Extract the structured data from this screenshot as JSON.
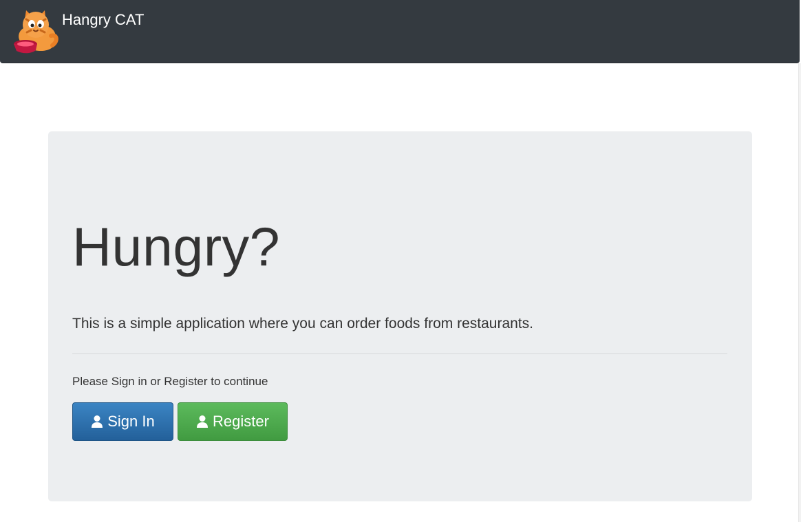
{
  "navbar": {
    "brand_name": "Hangry CAT",
    "logo_icon": "hungry-cat-logo-icon"
  },
  "jumbotron": {
    "title": "Hungry?",
    "lead": "This is a simple application where you can order foods from restaurants.",
    "prompt": "Please Sign in or Register to continue"
  },
  "actions": {
    "sign_in_label": "Sign In",
    "register_label": "Register",
    "sign_in_icon": "user-icon",
    "register_icon": "user-icon"
  },
  "colors": {
    "navbar_bg": "#343a40",
    "jumbotron_bg": "#eceef0",
    "sign_in_button": "#2d6fad",
    "register_button": "#4cae4c",
    "text": "#333333"
  }
}
